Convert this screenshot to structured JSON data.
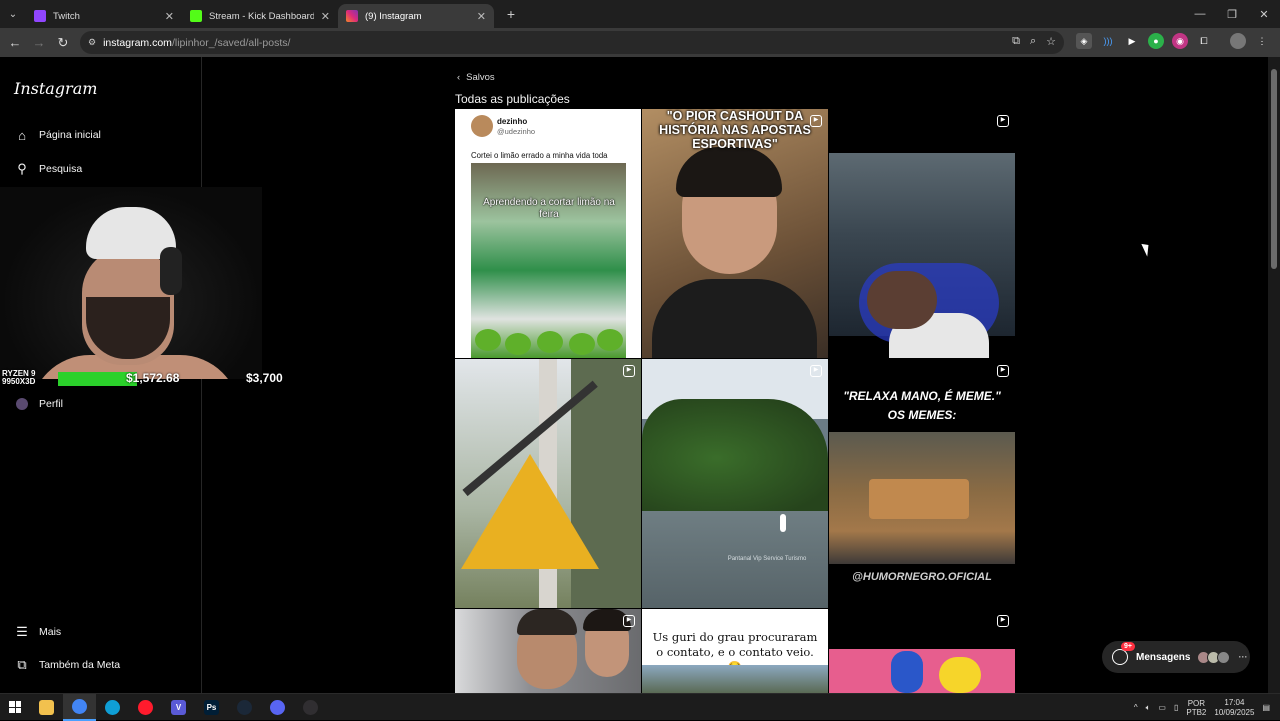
{
  "browser": {
    "tabs": [
      {
        "label": "Twitch",
        "favicon_color": "#9146ff",
        "active": false
      },
      {
        "label": "Stream - Kick Dashboard",
        "favicon_color": "#53fc18",
        "active": false
      },
      {
        "label": "(9) Instagram",
        "favicon_color": "#e1306c",
        "active": true
      }
    ],
    "url_host": "instagram.com",
    "url_path": "/lipinhor_/saved/all-posts/"
  },
  "sidebar": {
    "logo": "Instagram",
    "items": [
      {
        "label": "Página inicial",
        "icon": "home-icon"
      },
      {
        "label": "Pesquisa",
        "icon": "search-icon"
      },
      {
        "label": "Perfil",
        "icon": "profile-avatar"
      },
      {
        "label": "Mais",
        "icon": "menu-icon"
      },
      {
        "label": "Também da Meta",
        "icon": "meta-icon"
      }
    ]
  },
  "overlay": {
    "cpu_line1": "RYZEN 9",
    "cpu_line2": "9950X3D",
    "value_current": "$1,572.68",
    "value_goal": "$3,700",
    "progress_fraction": 0.42,
    "bar_color": "#2bd12b"
  },
  "main": {
    "back_label": "Salvos",
    "title": "Todas as publicações",
    "posts": {
      "p1": {
        "name": "dezinho",
        "handle": "@udezinho",
        "text": "Cortei o limão errado a minha vida toda",
        "caption": "Aprendendo a cortar limão na feira"
      },
      "p2": {
        "caption": "\"O PIOR CASHOUT DA HISTÓRIA NAS APOSTAS ESPORTIVAS\""
      },
      "p5": {
        "caption": "Pantanal Vip Service Turismo"
      },
      "p6": {
        "title_line1": "\"RELAXA MANO, É MEME.\"",
        "title_line2": "OS MEMES:",
        "credit": "@HUMORNEGRO.OFICIAL"
      },
      "p8": {
        "text": "Us guri do grau procuraram o contato, e o contato veio.😂"
      }
    }
  },
  "messages": {
    "label": "Mensagens",
    "badge": "9+"
  },
  "taskbar": {
    "apps": [
      {
        "name": "file-explorer",
        "glyph": "",
        "color": "#f2c14e"
      },
      {
        "name": "chrome",
        "glyph": "",
        "color": "#4285f4"
      },
      {
        "name": "edge",
        "glyph": "",
        "color": "#0f9ed5"
      },
      {
        "name": "opera",
        "glyph": "",
        "color": "#ff1b2d"
      },
      {
        "name": "vpn",
        "glyph": "V",
        "color": "#5a5ad6"
      },
      {
        "name": "photoshop",
        "glyph": "Ps",
        "color": "#001e36"
      },
      {
        "name": "steam",
        "glyph": "",
        "color": "#1b2838"
      },
      {
        "name": "discord",
        "glyph": "",
        "color": "#5865f2"
      },
      {
        "name": "obs",
        "glyph": "",
        "color": "#302e31"
      }
    ],
    "lang_line1": "POR",
    "lang_line2": "PTB2",
    "time": "17:04",
    "date": "10/09/2025"
  }
}
